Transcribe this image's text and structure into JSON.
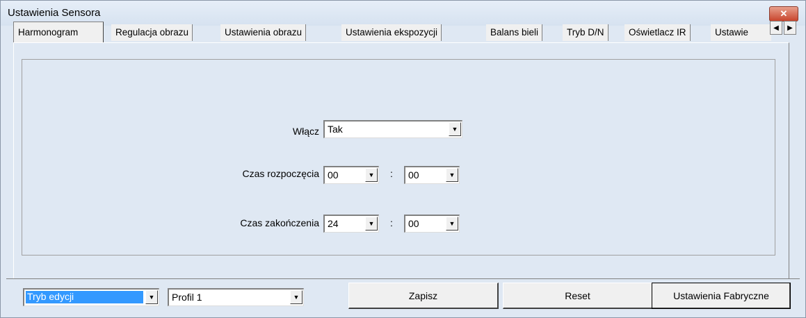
{
  "window": {
    "title": "Ustawienia Sensora",
    "close_label": "✕"
  },
  "tabs": [
    {
      "label": "Harmonogram"
    },
    {
      "label": "Regulacja obrazu"
    },
    {
      "label": "Ustawienia obrazu"
    },
    {
      "label": "Ustawienia ekspozycji"
    },
    {
      "label": "Balans bieli"
    },
    {
      "label": "Tryb D/N"
    },
    {
      "label": "Oświetlacz IR"
    },
    {
      "label": "Ustawie"
    }
  ],
  "tab_scroll": {
    "left": "◀",
    "right": "▶"
  },
  "schedule": {
    "enable_label": "Włącz",
    "enable_value": "Tak",
    "start_label": "Czas rozpoczęcia",
    "start_hour": "00",
    "start_minute": "00",
    "end_label": "Czas zakończenia",
    "end_hour": "24",
    "end_minute": "00",
    "separator": ":"
  },
  "bottom": {
    "mode_value": "Tryb edycji",
    "profile_value": "Profil 1",
    "save_label": "Zapisz",
    "reset_label": "Reset",
    "factory_label": "Ustawienia Fabryczne"
  },
  "icons": {
    "dropdown_arrow": "▼"
  }
}
